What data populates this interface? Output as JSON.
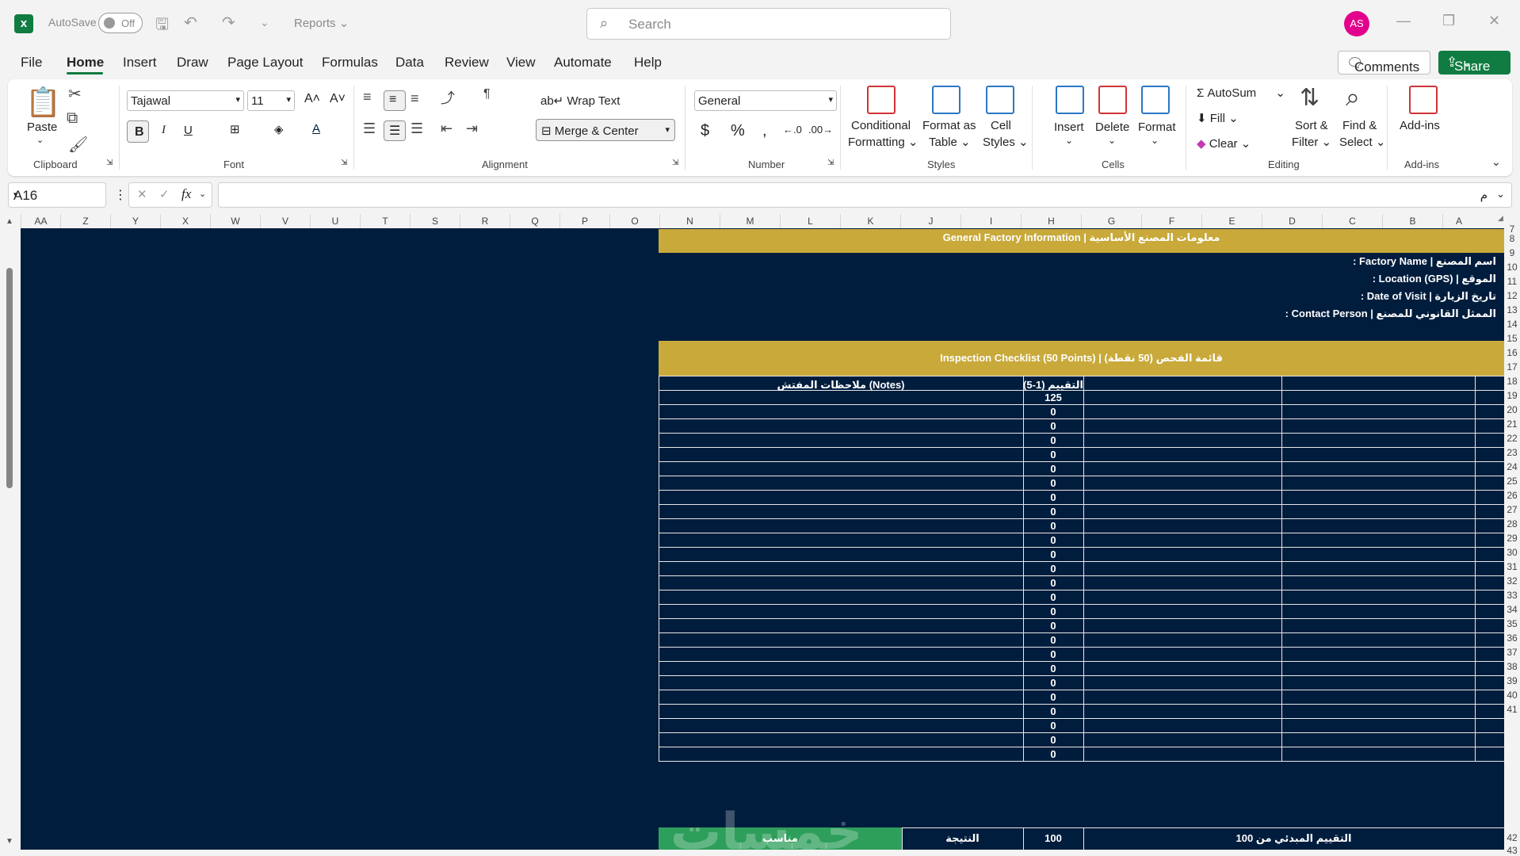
{
  "titlebar": {
    "autosave_label": "AutoSave",
    "autosave_state": "Off",
    "doc_name": "Reports",
    "search_placeholder": "Search",
    "avatar_initials": "AS"
  },
  "menu": {
    "items": [
      "File",
      "Home",
      "Insert",
      "Draw",
      "Page Layout",
      "Formulas",
      "Data",
      "Review",
      "View",
      "Automate",
      "Help"
    ],
    "active": "Home",
    "comments_label": "Comments",
    "share_label": "Share"
  },
  "ribbon": {
    "clipboard": {
      "paste": "Paste",
      "label": "Clipboard"
    },
    "font": {
      "name": "Tajawal",
      "size": "11",
      "label": "Font"
    },
    "alignment": {
      "wrap": "Wrap Text",
      "merge": "Merge & Center",
      "label": "Alignment"
    },
    "number": {
      "format": "General",
      "label": "Number"
    },
    "styles": {
      "cond1": "Conditional",
      "cond2": "Formatting",
      "fat1": "Format as",
      "fat2": "Table",
      "cs1": "Cell",
      "cs2": "Styles",
      "label": "Styles"
    },
    "cells": {
      "insert": "Insert",
      "delete": "Delete",
      "format": "Format",
      "label": "Cells"
    },
    "editing": {
      "autosum": "AutoSum",
      "fill": "Fill",
      "clear": "Clear",
      "sort1": "Sort &",
      "sort2": "Filter",
      "find1": "Find &",
      "find2": "Select",
      "label": "Editing"
    },
    "addins": {
      "btn": "Add-ins",
      "label": "Add-ins"
    }
  },
  "formula": {
    "cell_ref": "A16",
    "content": "م"
  },
  "columns": [
    "AA",
    "Z",
    "Y",
    "X",
    "W",
    "V",
    "U",
    "T",
    "S",
    "R",
    "Q",
    "P",
    "O",
    "N",
    "M",
    "L",
    "K",
    "J",
    "I",
    "H",
    "G",
    "F",
    "E",
    "D",
    "C",
    "B",
    "A"
  ],
  "rows": [
    "7",
    "8",
    "9",
    "10",
    "11",
    "12",
    "13",
    "14",
    "15",
    "16",
    "17",
    "18",
    "19",
    "20",
    "21",
    "22",
    "23",
    "24",
    "25",
    "26",
    "27",
    "28",
    "29",
    "30",
    "31",
    "32",
    "33",
    "34",
    "35",
    "36",
    "37",
    "38",
    "39",
    "40",
    "41",
    "42",
    "43"
  ],
  "sheet": {
    "general_header": "General Factory Information | معلومات المصنع الأساسية",
    "factory_name": "اسم المصنع | Factory Name :",
    "location": "الموقع | Location (GPS) :",
    "visit_date": "تاريخ الزيارة | Date of Visit :",
    "contact": "الممثل القانوني للمصنع | Contact Person :",
    "checklist_header": "Inspection Checklist (50 Points) | قائمة الفحص (50 نقطة)",
    "rating_header": "التقييم (1-5)",
    "notes_header": "ملاحظات المفتش (Notes)",
    "rating_values": [
      "125",
      "0",
      "0",
      "0",
      "0",
      "0",
      "0",
      "0",
      "0",
      "0",
      "0",
      "0",
      "0",
      "0",
      "0",
      "0",
      "0",
      "0",
      "0",
      "0",
      "0",
      "0",
      "0",
      "0",
      "0",
      "0"
    ],
    "footer_label": "التقييم المبدئي من 100",
    "footer_score": "100",
    "footer_result_label": "النتيجة",
    "footer_result": "مناسب",
    "watermark": "خمسات"
  },
  "colors": {
    "sheet_bg": "#001d3d",
    "gold": "#c8a93a",
    "green": "#2e9e5b",
    "brand": "#107c41"
  }
}
